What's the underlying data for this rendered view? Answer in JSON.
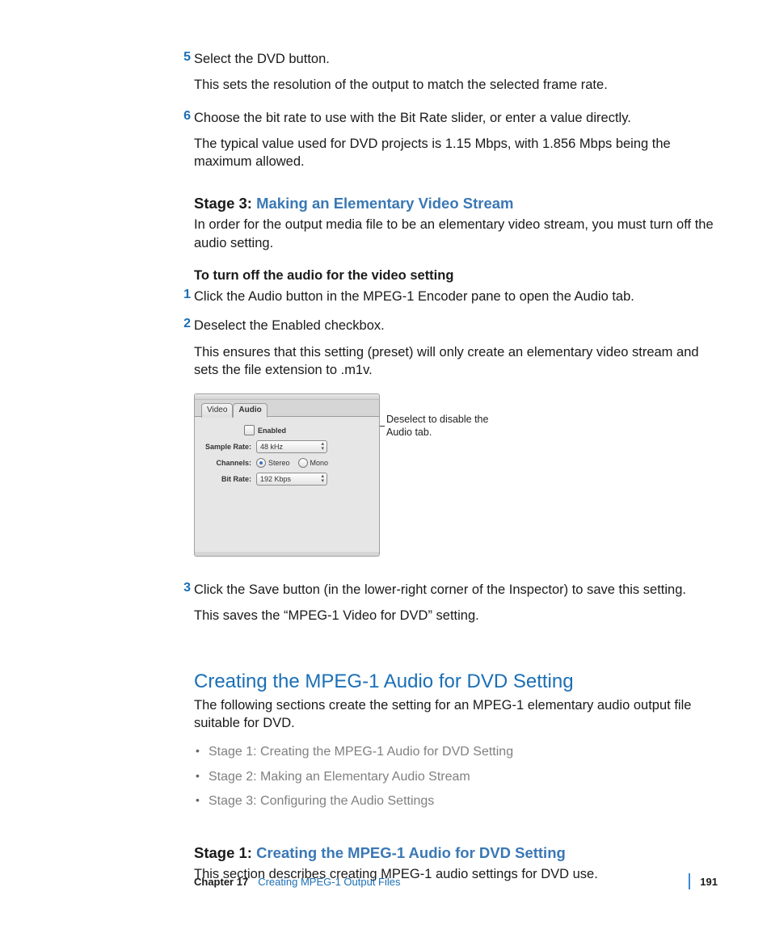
{
  "stepsA": [
    {
      "n": "5",
      "main": "Select the DVD button.",
      "sub": "This sets the resolution of the output to match the selected frame rate."
    },
    {
      "n": "6",
      "main": "Choose the bit rate to use with the Bit Rate slider, or enter a value directly.",
      "sub": "The typical value used for DVD projects is 1.15 Mbps, with 1.856 Mbps being the maximum allowed."
    }
  ],
  "stage3": {
    "label": "Stage 3:",
    "title": "Making an Elementary Video Stream",
    "intro": "In order for the output media file to be an elementary video stream, you must turn off the audio setting.",
    "taskHeading": "To turn off the audio for the video setting"
  },
  "stepsB": [
    {
      "n": "1",
      "main": "Click the Audio button in the MPEG-1 Encoder pane to open the Audio tab.",
      "sub": ""
    },
    {
      "n": "2",
      "main": "Deselect the Enabled checkbox.",
      "sub": "This ensures that this setting (preset) will only create an elementary video stream and sets the file extension to .m1v."
    }
  ],
  "panel": {
    "tabs": {
      "video": "Video",
      "audio": "Audio"
    },
    "enabledLabel": "Enabled",
    "sampleRate": {
      "label": "Sample Rate:",
      "value": "48 kHz"
    },
    "channels": {
      "label": "Channels:",
      "stereo": "Stereo",
      "mono": "Mono"
    },
    "bitRate": {
      "label": "Bit Rate:",
      "value": "192 Kbps"
    }
  },
  "callout": "Deselect to disable the Audio tab.",
  "stepsC": [
    {
      "n": "3",
      "main": "Click the Save button (in the lower-right corner of the Inspector) to save this setting.",
      "sub": "This saves the “MPEG-1 Video for DVD” setting."
    }
  ],
  "section": {
    "title": "Creating the MPEG-1 Audio for DVD Setting",
    "intro": "The following sections create the setting for an MPEG-1 elementary audio output file suitable for DVD.",
    "links": [
      "Stage 1: Creating the MPEG-1 Audio for DVD Setting",
      "Stage 2: Making an Elementary Audio Stream",
      "Stage 3: Configuring the Audio Settings"
    ]
  },
  "stage1": {
    "label": "Stage 1:",
    "title": "Creating the MPEG-1 Audio for DVD Setting",
    "intro": "This section describes creating MPEG-1 audio settings for DVD use."
  },
  "footer": {
    "chapter": "Chapter 17",
    "title": "Creating MPEG-1 Output Files",
    "page": "191"
  }
}
